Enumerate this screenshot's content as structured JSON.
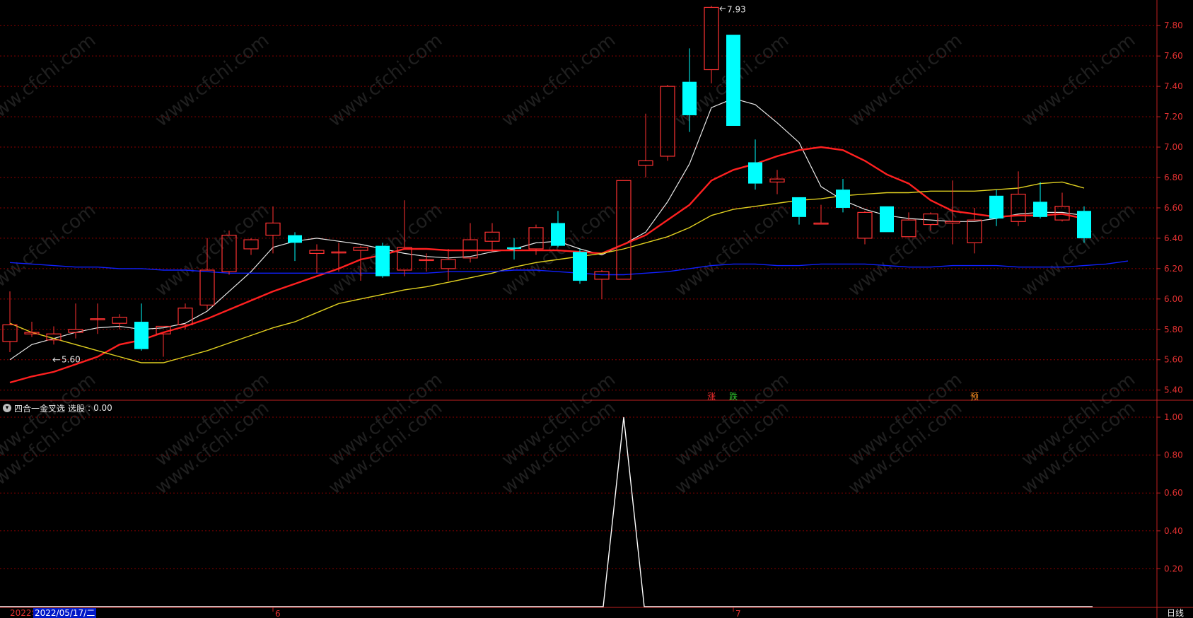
{
  "watermark": "www.cfchi.com",
  "indicator": {
    "name": "四合一金叉选",
    "field": "选股",
    "value": "0.00"
  },
  "cursor_date": "2022/05/17/二",
  "first_date_year": "2022年",
  "period": "日线",
  "markers": [
    {
      "label": "涨",
      "color": "#ff3030",
      "index": 32
    },
    {
      "label": "跌",
      "color": "#30d030",
      "index": 33
    },
    {
      "label": "预",
      "color": "#ff9020",
      "index": 44
    }
  ],
  "annotations": {
    "high": "7.93",
    "low": "5.60"
  },
  "month_labels": [
    {
      "text": "6",
      "index": 12
    },
    {
      "text": "7",
      "index": 33
    }
  ],
  "colors": {
    "up": "#ff3232",
    "down": "#00ffff",
    "ma5": "#e8e8e8",
    "ma10": "#ff2020",
    "ma20": "#e0d020",
    "ma60": "#1020ff",
    "grid": "#8a0000",
    "signal": "#ffffff"
  },
  "chart_data": [
    {
      "type": "candlestick",
      "ylim": [
        5.38,
        7.95
      ],
      "yticks": [
        5.4,
        5.6,
        5.8,
        6.0,
        6.2,
        6.4,
        6.6,
        6.8,
        7.0,
        7.2,
        7.4,
        7.6,
        7.8
      ],
      "candles": [
        {
          "o": 5.72,
          "h": 6.05,
          "l": 5.65,
          "c": 5.83
        },
        {
          "o": 5.77,
          "h": 5.85,
          "l": 5.75,
          "c": 5.78
        },
        {
          "o": 5.73,
          "h": 5.82,
          "l": 5.7,
          "c": 5.77
        },
        {
          "o": 5.78,
          "h": 5.97,
          "l": 5.74,
          "c": 5.8
        },
        {
          "o": 5.87,
          "h": 5.97,
          "l": 5.77,
          "c": 5.87
        },
        {
          "o": 5.84,
          "h": 5.9,
          "l": 5.8,
          "c": 5.88
        },
        {
          "o": 5.85,
          "h": 5.97,
          "l": 5.66,
          "c": 5.67
        },
        {
          "o": 5.77,
          "h": 5.82,
          "l": 5.62,
          "c": 5.82
        },
        {
          "o": 5.83,
          "h": 5.97,
          "l": 5.8,
          "c": 5.94
        },
        {
          "o": 5.96,
          "h": 6.4,
          "l": 5.93,
          "c": 6.19
        },
        {
          "o": 6.18,
          "h": 6.45,
          "l": 6.16,
          "c": 6.42
        },
        {
          "o": 6.33,
          "h": 6.4,
          "l": 6.29,
          "c": 6.39
        },
        {
          "o": 6.42,
          "h": 6.61,
          "l": 6.3,
          "c": 6.5
        },
        {
          "o": 6.42,
          "h": 6.44,
          "l": 6.25,
          "c": 6.37
        },
        {
          "o": 6.3,
          "h": 6.36,
          "l": 6.17,
          "c": 6.32
        },
        {
          "o": 6.31,
          "h": 6.37,
          "l": 6.18,
          "c": 6.31
        },
        {
          "o": 6.32,
          "h": 6.35,
          "l": 6.12,
          "c": 6.34
        },
        {
          "o": 6.35,
          "h": 6.37,
          "l": 6.14,
          "c": 6.15
        },
        {
          "o": 6.19,
          "h": 6.65,
          "l": 6.15,
          "c": 6.34
        },
        {
          "o": 6.26,
          "h": 6.3,
          "l": 6.18,
          "c": 6.26
        },
        {
          "o": 6.2,
          "h": 6.33,
          "l": 6.12,
          "c": 6.26
        },
        {
          "o": 6.27,
          "h": 6.5,
          "l": 6.24,
          "c": 6.39
        },
        {
          "o": 6.38,
          "h": 6.5,
          "l": 6.31,
          "c": 6.44
        },
        {
          "o": 6.34,
          "h": 6.4,
          "l": 6.26,
          "c": 6.33
        },
        {
          "o": 6.33,
          "h": 6.49,
          "l": 6.29,
          "c": 6.47
        },
        {
          "o": 6.5,
          "h": 6.58,
          "l": 6.34,
          "c": 6.35
        },
        {
          "o": 6.31,
          "h": 6.33,
          "l": 6.1,
          "c": 6.12
        },
        {
          "o": 6.13,
          "h": 6.19,
          "l": 6.0,
          "c": 6.18
        },
        {
          "o": 6.13,
          "h": 6.78,
          "l": 6.13,
          "c": 6.78
        },
        {
          "o": 6.88,
          "h": 7.22,
          "l": 6.8,
          "c": 6.91
        },
        {
          "o": 6.94,
          "h": 7.41,
          "l": 6.91,
          "c": 7.4
        },
        {
          "o": 7.43,
          "h": 7.65,
          "l": 7.1,
          "c": 7.21
        },
        {
          "o": 7.51,
          "h": 7.93,
          "l": 7.42,
          "c": 7.92
        },
        {
          "o": 7.74,
          "h": 7.74,
          "l": 7.14,
          "c": 7.14
        },
        {
          "o": 6.9,
          "h": 7.05,
          "l": 6.72,
          "c": 6.76
        },
        {
          "o": 6.77,
          "h": 6.85,
          "l": 6.69,
          "c": 6.79
        },
        {
          "o": 6.67,
          "h": 6.67,
          "l": 6.49,
          "c": 6.54
        },
        {
          "o": 6.5,
          "h": 6.62,
          "l": 6.5,
          "c": 6.5
        },
        {
          "o": 6.72,
          "h": 6.79,
          "l": 6.57,
          "c": 6.6
        },
        {
          "o": 6.4,
          "h": 6.58,
          "l": 6.36,
          "c": 6.57
        },
        {
          "o": 6.61,
          "h": 6.61,
          "l": 6.44,
          "c": 6.44
        },
        {
          "o": 6.41,
          "h": 6.57,
          "l": 6.41,
          "c": 6.52
        },
        {
          "o": 6.49,
          "h": 6.57,
          "l": 6.45,
          "c": 6.56
        },
        {
          "o": 6.5,
          "h": 6.78,
          "l": 6.36,
          "c": 6.51
        },
        {
          "o": 6.37,
          "h": 6.6,
          "l": 6.3,
          "c": 6.52
        },
        {
          "o": 6.68,
          "h": 6.72,
          "l": 6.48,
          "c": 6.53
        },
        {
          "o": 6.51,
          "h": 6.84,
          "l": 6.48,
          "c": 6.69
        },
        {
          "o": 6.64,
          "h": 6.77,
          "l": 6.53,
          "c": 6.54
        },
        {
          "o": 6.52,
          "h": 6.7,
          "l": 6.51,
          "c": 6.61
        },
        {
          "o": 6.58,
          "h": 6.61,
          "l": 6.37,
          "c": 6.4
        }
      ],
      "series": [
        {
          "key": "ma5",
          "values": [
            5.6,
            5.7,
            5.74,
            5.78,
            5.81,
            5.82,
            5.8,
            5.81,
            5.84,
            5.92,
            6.05,
            6.18,
            6.34,
            6.38,
            6.4,
            6.38,
            6.36,
            6.33,
            6.3,
            6.28,
            6.27,
            6.28,
            6.31,
            6.33,
            6.37,
            6.38,
            6.33,
            6.29,
            6.36,
            6.44,
            6.64,
            6.89,
            7.26,
            7.32,
            7.28,
            7.16,
            7.03,
            6.74,
            6.65,
            6.59,
            6.55,
            6.53,
            6.52,
            6.51,
            6.51,
            6.53,
            6.56,
            6.57,
            6.57,
            6.55
          ]
        },
        {
          "key": "ma10",
          "values": [
            5.45,
            5.49,
            5.52,
            5.57,
            5.62,
            5.7,
            5.73,
            5.78,
            5.82,
            5.87,
            5.93,
            5.99,
            6.05,
            6.1,
            6.15,
            6.2,
            6.26,
            6.29,
            6.33,
            6.33,
            6.32,
            6.32,
            6.32,
            6.32,
            6.32,
            6.32,
            6.31,
            6.3,
            6.36,
            6.42,
            6.52,
            6.62,
            6.78,
            6.85,
            6.89,
            6.94,
            6.98,
            7.0,
            6.98,
            6.91,
            6.82,
            6.76,
            6.65,
            6.58,
            6.56,
            6.54,
            6.55,
            6.55,
            6.56,
            6.53
          ]
        },
        {
          "key": "ma20",
          "values": [
            5.84,
            5.78,
            5.74,
            5.7,
            5.66,
            5.62,
            5.58,
            5.58,
            5.62,
            5.66,
            5.71,
            5.76,
            5.81,
            5.85,
            5.91,
            5.97,
            6.0,
            6.03,
            6.06,
            6.08,
            6.11,
            6.14,
            6.17,
            6.21,
            6.24,
            6.26,
            6.28,
            6.3,
            6.33,
            6.37,
            6.41,
            6.47,
            6.55,
            6.59,
            6.61,
            6.63,
            6.65,
            6.66,
            6.68,
            6.69,
            6.7,
            6.7,
            6.71,
            6.71,
            6.71,
            6.72,
            6.73,
            6.76,
            6.77,
            6.73
          ]
        },
        {
          "key": "ma60",
          "values": [
            6.24,
            6.23,
            6.22,
            6.21,
            6.21,
            6.2,
            6.2,
            6.19,
            6.19,
            6.18,
            6.17,
            6.17,
            6.17,
            6.17,
            6.17,
            6.17,
            6.17,
            6.17,
            6.17,
            6.17,
            6.18,
            6.18,
            6.18,
            6.19,
            6.19,
            6.18,
            6.17,
            6.16,
            6.16,
            6.17,
            6.18,
            6.2,
            6.22,
            6.23,
            6.23,
            6.22,
            6.22,
            6.23,
            6.23,
            6.23,
            6.22,
            6.21,
            6.21,
            6.22,
            6.22,
            6.22,
            6.21,
            6.21,
            6.21,
            6.22,
            6.23,
            6.25
          ]
        }
      ]
    },
    {
      "type": "line",
      "ylim": [
        0,
        1.05
      ],
      "yticks": [
        0.2,
        0.4,
        0.6,
        0.8,
        1.0
      ],
      "series": [
        {
          "key": "signal",
          "values": [
            0,
            0,
            0,
            0,
            0,
            0,
            0,
            0,
            0,
            0,
            0,
            0,
            0,
            0,
            0,
            0,
            0,
            0,
            0,
            0,
            0,
            0,
            0,
            0,
            0,
            0,
            0,
            0,
            1,
            0,
            0,
            0,
            0,
            0,
            0,
            0,
            0,
            0,
            0,
            0,
            0,
            0,
            0,
            0,
            0,
            0,
            0,
            0,
            0,
            0
          ]
        }
      ]
    }
  ]
}
